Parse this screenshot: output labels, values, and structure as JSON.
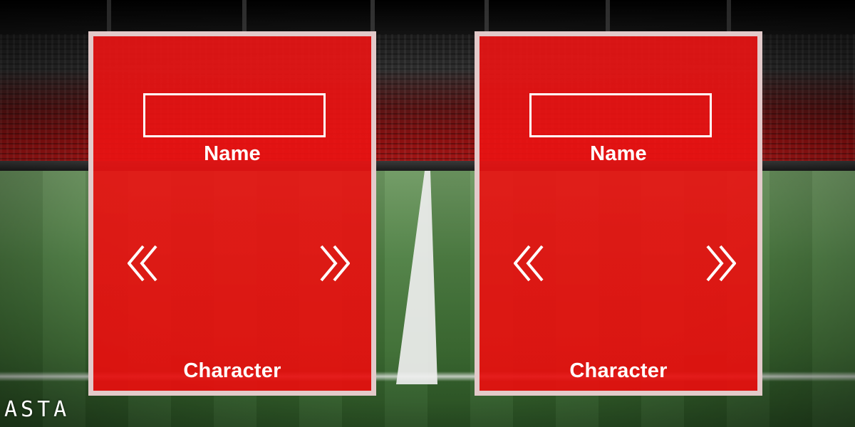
{
  "logo": {
    "text": "ASTA"
  },
  "players": [
    {
      "name_label": "Name",
      "name_value": "",
      "character_label": "Character",
      "prev_icon": "double-chevron-left-icon",
      "next_icon": "double-chevron-right-icon"
    },
    {
      "name_label": "Name",
      "name_value": "",
      "character_label": "Character",
      "prev_icon": "double-chevron-left-icon",
      "next_icon": "double-chevron-right-icon"
    }
  ],
  "colors": {
    "panel_fill": "#ea1414",
    "panel_border": "#e4e4e4",
    "text": "#ffffff"
  }
}
